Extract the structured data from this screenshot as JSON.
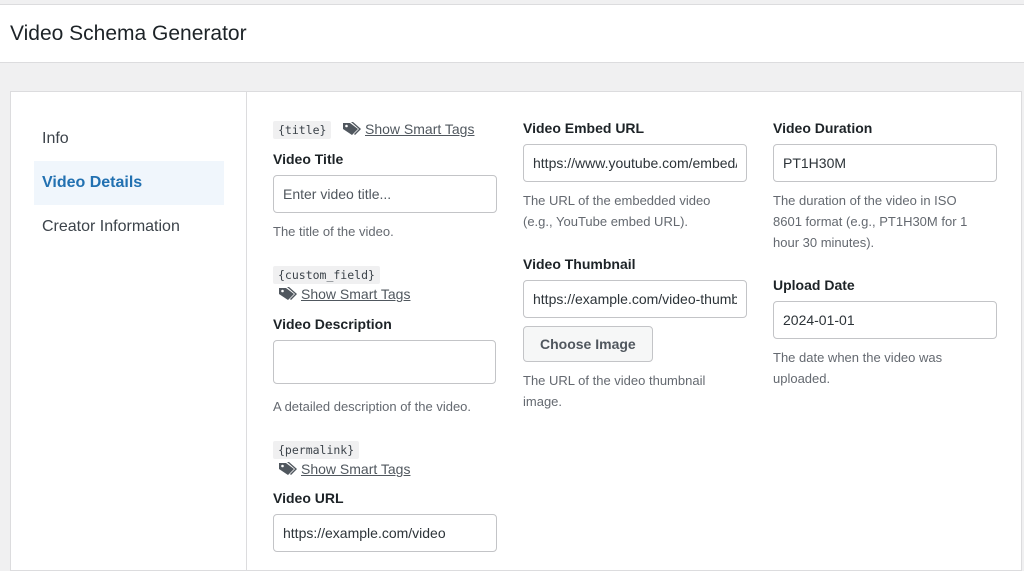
{
  "header": {
    "title": "Video Schema Generator"
  },
  "sidebar": {
    "items": [
      {
        "label": "Info"
      },
      {
        "label": "Video Details"
      },
      {
        "label": "Creator Information"
      }
    ]
  },
  "smart_tags_label": "Show Smart Tags",
  "fields": {
    "title": {
      "tag": "{title}",
      "label": "Video Title",
      "value": "",
      "placeholder": "Enter video title...",
      "help": "The title of the video."
    },
    "description": {
      "tag": "{custom_field}",
      "label": "Video Description",
      "value": "",
      "placeholder": "",
      "help": "A detailed description of the video."
    },
    "url": {
      "tag": "{permalink}",
      "label": "Video URL",
      "value": "https://example.com/video"
    },
    "embed_url": {
      "label": "Video Embed URL",
      "value": "https://www.youtube.com/embed/",
      "help_line1": "The URL of the embedded video",
      "help_line2": "(e.g., YouTube embed URL)."
    },
    "thumbnail": {
      "label": "Video Thumbnail",
      "value": "https://example.com/video-thumbnail.jpg",
      "button": "Choose Image",
      "help_line1": "The URL of the video thumbnail",
      "help_line2": "image."
    },
    "duration": {
      "label": "Video Duration",
      "value": "PT1H30M",
      "help_line1": "The duration of the video in ISO",
      "help_line2": "8601 format (e.g., PT1H30M for 1",
      "help_line3": "hour 30 minutes)."
    },
    "upload_date": {
      "label": "Upload Date",
      "value": "2024-01-01",
      "help_line1": "The date when the video was",
      "help_line2": "uploaded."
    }
  },
  "icons": {
    "smart_tags": "tag-icon"
  },
  "colors": {
    "accent": "#2271b1",
    "active_bg": "#f0f6fc"
  }
}
